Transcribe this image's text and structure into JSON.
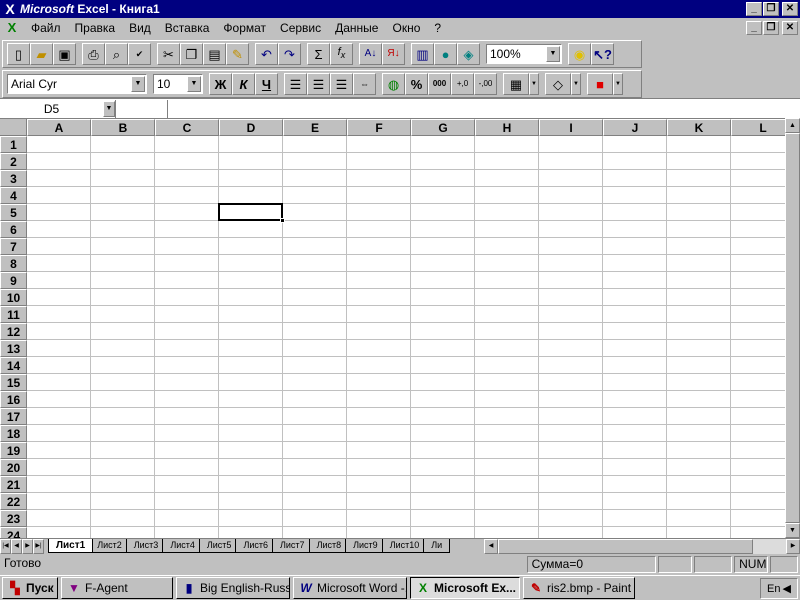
{
  "titlebar": {
    "brand": "Microsoft",
    "title": "Excel - Книга1",
    "min_glyph": "_",
    "restore_glyph": "❐",
    "close_glyph": "✕"
  },
  "menubar": {
    "items": [
      {
        "label": "Файл"
      },
      {
        "label": "Правка"
      },
      {
        "label": "Вид"
      },
      {
        "label": "Вставка"
      },
      {
        "label": "Формат"
      },
      {
        "label": "Сервис"
      },
      {
        "label": "Данные"
      },
      {
        "label": "Окно"
      },
      {
        "label": "?"
      }
    ]
  },
  "toolbar_std": {
    "zoom": "100%"
  },
  "toolbar_fmt": {
    "font": "Arial Cyr",
    "size": "10",
    "bold": "Ж",
    "italic": "К",
    "underline": "Ч",
    "percent": "%",
    "thousands": "000",
    "inc_decimal": "+,0",
    "dec_decimal": "-,00"
  },
  "formula_bar": {
    "name_box": "D5",
    "formula": ""
  },
  "grid": {
    "columns": [
      "A",
      "B",
      "C",
      "D",
      "E",
      "F",
      "G",
      "H",
      "I",
      "J",
      "K",
      "L"
    ],
    "rows": [
      "1",
      "2",
      "3",
      "4",
      "5",
      "6",
      "7",
      "8",
      "9",
      "10",
      "11",
      "12",
      "13",
      "14",
      "15",
      "16",
      "17",
      "18",
      "19",
      "20",
      "21",
      "22",
      "23",
      "24"
    ],
    "active_cell": "D5"
  },
  "sheets": {
    "tabs": [
      "Лист1",
      "Лист2",
      "Лист3",
      "Лист4",
      "Лист5",
      "Лист6",
      "Лист7",
      "Лист8",
      "Лист9",
      "Лист10",
      "Ли"
    ],
    "active": "Лист1"
  },
  "statusbar": {
    "ready": "Готово",
    "sum": "Сумма=0",
    "num": "NUM"
  },
  "taskbar": {
    "start": "Пуск",
    "tasks": [
      {
        "label": "F-Agent",
        "pressed": false
      },
      {
        "label": "Big English-Russ...",
        "pressed": false
      },
      {
        "label": "Microsoft Word -...",
        "pressed": false
      },
      {
        "label": "Microsoft Ex...",
        "pressed": true
      },
      {
        "label": "ris2.bmp - Paint",
        "pressed": false
      }
    ],
    "lang": "En"
  }
}
